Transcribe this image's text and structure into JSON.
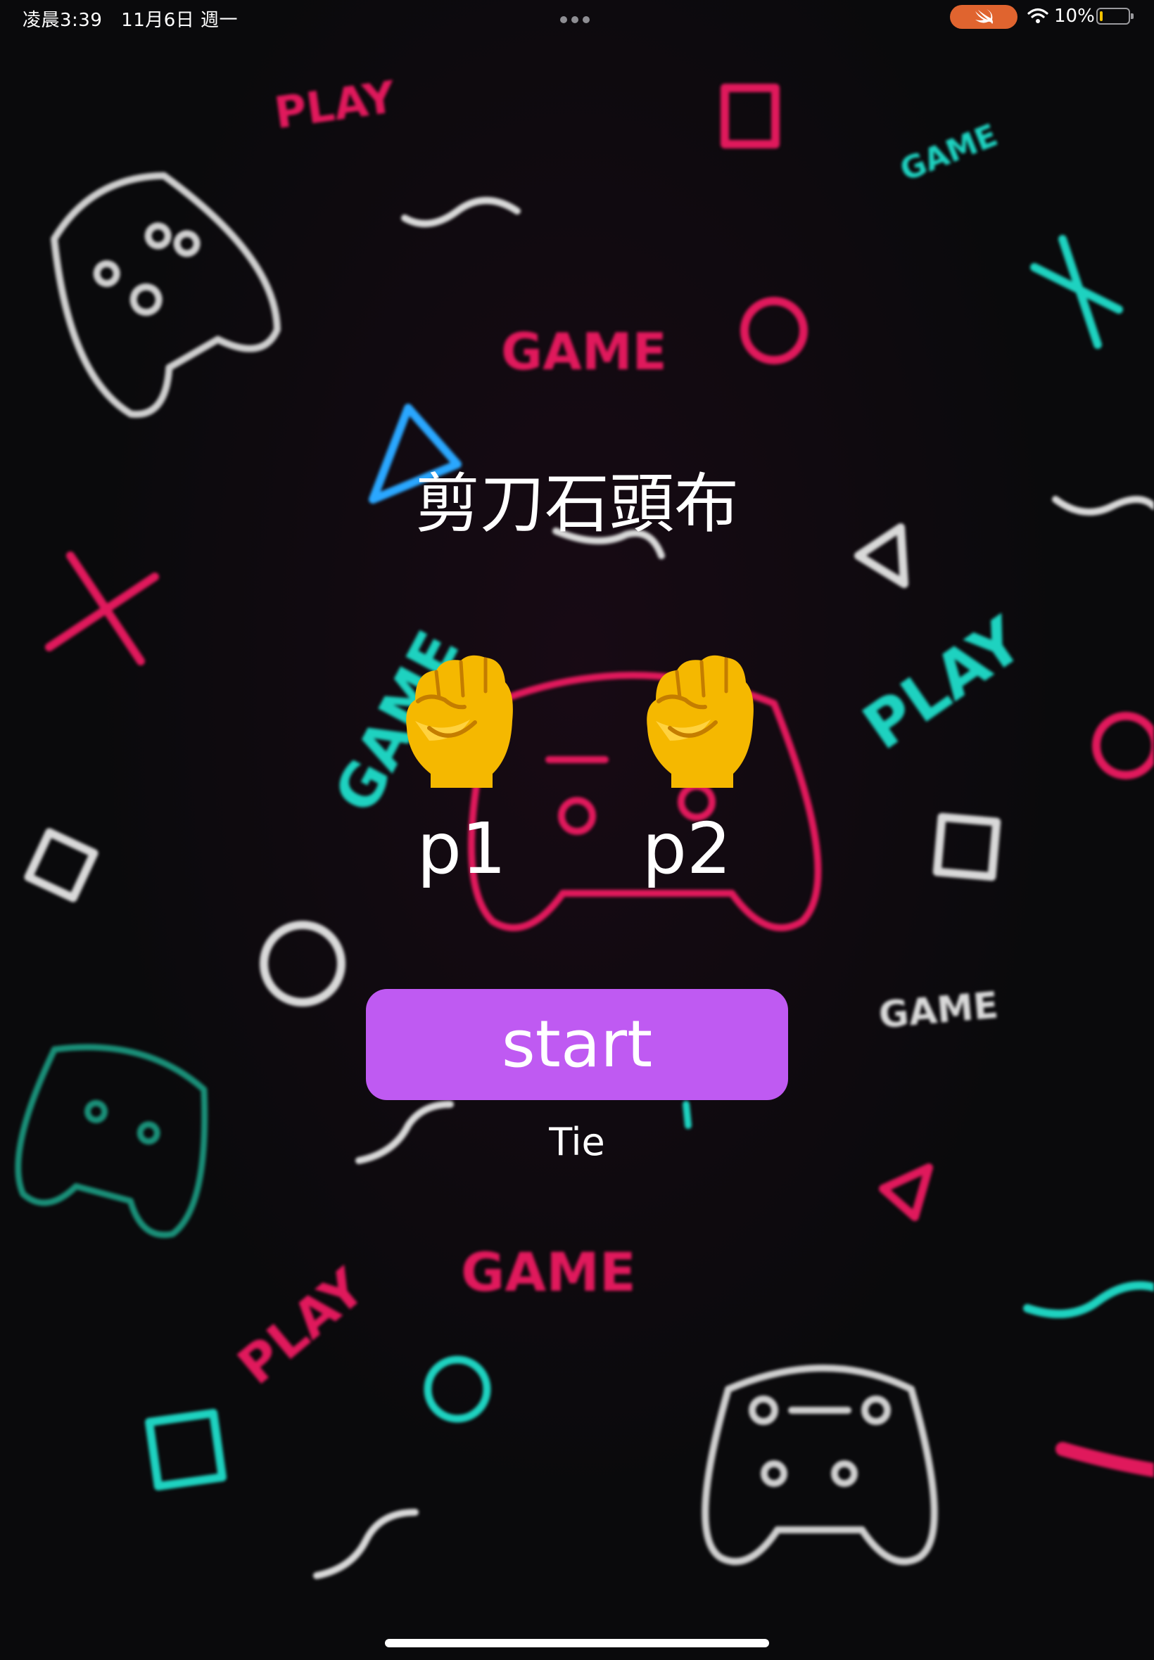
{
  "status_bar": {
    "time": "凌晨3:39",
    "date": "11月6日 週一",
    "battery_percent": "10%",
    "battery_level": 0.1,
    "icons": [
      "more-dots-icon",
      "swift-icon",
      "wifi-icon",
      "battery-icon"
    ],
    "swift_pill_color": "#e0642f",
    "battery_fill_color": "#f5c400"
  },
  "background_words": {
    "play": "PLAY",
    "game": "GAME"
  },
  "game": {
    "title": "剪刀石頭布",
    "player1": {
      "label": "p1",
      "hand": "rock",
      "hand_icon": "raised-fist-icon"
    },
    "player2": {
      "label": "p2",
      "hand": "rock",
      "hand_icon": "raised-fist-icon"
    },
    "start_label": "start",
    "result": "Tie"
  },
  "colors": {
    "background": "#0a0a0c",
    "start_button": "#bf5af2",
    "neon_pink": "#e0195c",
    "neon_teal": "#1ed2c0",
    "neon_white": "#d9d9d9"
  }
}
